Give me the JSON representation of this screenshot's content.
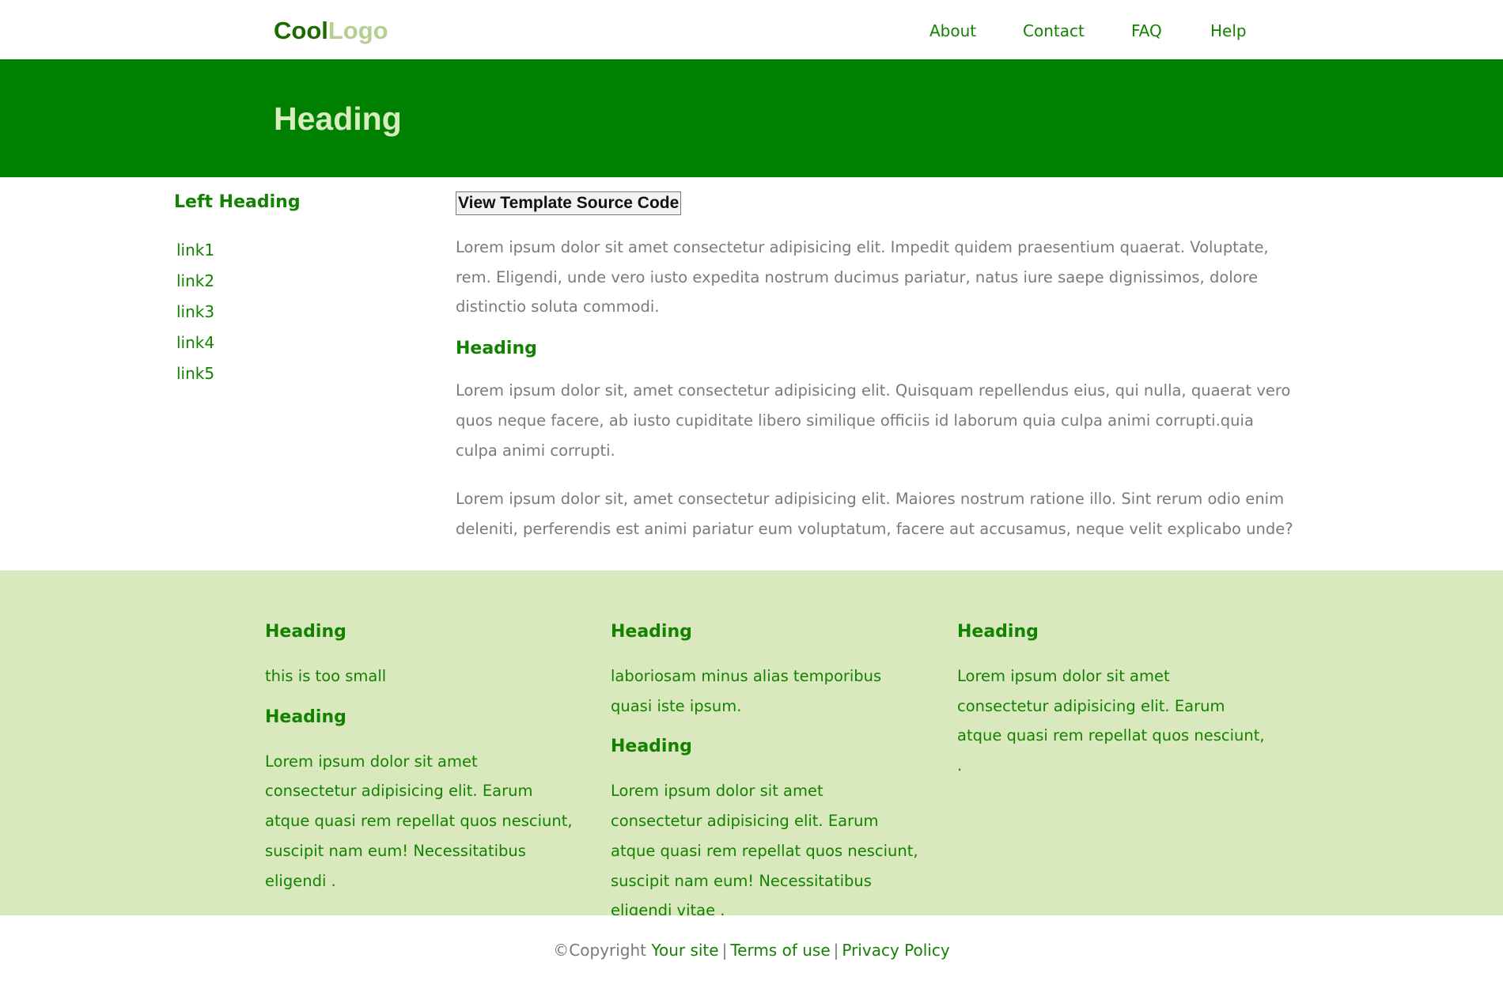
{
  "header": {
    "logo_part1": "Cool",
    "logo_part2": "Logo",
    "nav": [
      "About",
      "Contact",
      "FAQ",
      "Help"
    ]
  },
  "hero": {
    "title": "Heading"
  },
  "sidebar": {
    "heading": "Left Heading",
    "links": [
      "link1",
      "link2",
      "link3",
      "link4",
      "link5"
    ]
  },
  "main": {
    "button_label": "View Template Source Code",
    "paragraph1": "Lorem ipsum dolor sit amet consectetur adipisicing elit. Impedit quidem praesentium quaerat. Voluptate, rem. Eligendi, unde vero iusto expedita nostrum ducimus pariatur, natus iure saepe dignissimos, dolore distinctio soluta commodi.",
    "heading": "Heading",
    "paragraph2": "Lorem ipsum dolor sit, amet consectetur adipisicing elit. Quisquam repellendus eius, qui nulla, quaerat vero quos neque facere, ab iusto cupiditate libero similique officiis id laborum quia culpa animi corrupti.quia culpa animi corrupti.",
    "paragraph3": "Lorem ipsum dolor sit, amet consectetur adipisicing elit. Maiores nostrum ratione illo. Sint rerum odio enim deleniti, perferendis est animi pariatur eum voluptatum, facere aut accusamus, neque velit explicabo unde?"
  },
  "footer": {
    "col1": {
      "heading1": "Heading",
      "text1": "this is too small",
      "heading2": "Heading",
      "text2": "Lorem ipsum dolor sit amet consectetur adipisicing elit. Earum atque quasi rem repellat quos nesciunt, suscipit nam eum! Necessitatibus eligendi ."
    },
    "col2": {
      "heading1": "Heading",
      "text1": "laboriosam minus alias temporibus quasi iste ipsum.",
      "heading2": "Heading",
      "text2": "Lorem ipsum dolor sit amet consectetur adipisicing elit. Earum atque quasi rem repellat quos nesciunt, suscipit nam eum! Necessitatibus eligendi vitae ."
    },
    "col3": {
      "heading1": "Heading",
      "text1": "Lorem ipsum dolor sit amet consectetur adipisicing elit. Earum atque quasi rem repellat quos nesciunt, ."
    }
  },
  "bottom": {
    "copyright": "©Copyright",
    "link_site": "Your site",
    "separator": "|",
    "link_terms": "Terms of use",
    "link_privacy": "Privacy Policy"
  },
  "colors": {
    "brand_green": "#008000",
    "link_green": "#138200",
    "hero_text": "#d8ecbd",
    "footer_bg": "#dae9bd",
    "body_text": "#7a7a7a"
  }
}
